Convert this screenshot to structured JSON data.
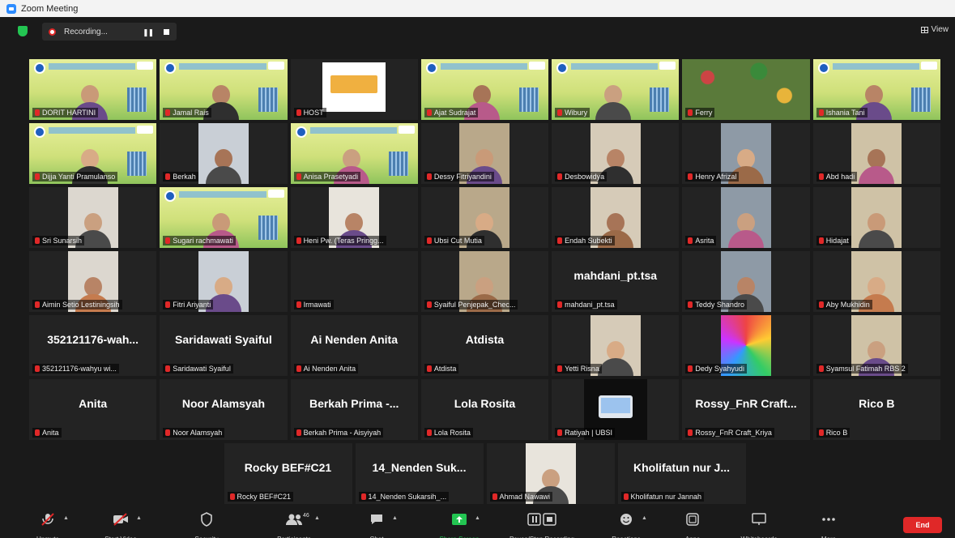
{
  "window": {
    "title": "Zoom Meeting"
  },
  "topbar": {
    "recording_label": "Recording...",
    "view_label": "View"
  },
  "rows": [
    [
      {
        "label": "DORIT HARTINI",
        "type": "banner",
        "active": true
      },
      {
        "label": "Jamal Rais",
        "type": "banner"
      },
      {
        "label": "HOST",
        "type": "screen"
      },
      {
        "label": "Ajat Sudrajat",
        "type": "banner"
      },
      {
        "label": "Wibury",
        "type": "banner"
      },
      {
        "label": "Ferry",
        "type": "floral"
      },
      {
        "label": "Ishania Tani",
        "type": "banner"
      }
    ],
    [
      {
        "label": "Dijja Yanti Pramulanso",
        "type": "banner"
      },
      {
        "label": "Berkah",
        "type": "video"
      },
      {
        "label": "Anisa Prasetyadi",
        "type": "banner"
      },
      {
        "label": "Dessy Fitriyandini",
        "type": "video"
      },
      {
        "label": "Desbowidya",
        "type": "video"
      },
      {
        "label": "Henry Afrizal",
        "type": "video"
      },
      {
        "label": "Abd hadi",
        "type": "video"
      }
    ],
    [
      {
        "label": "Sri Sunarsih",
        "type": "video"
      },
      {
        "label": "Sugari rachmawati",
        "type": "banner"
      },
      {
        "label": "Heni Pw. (Teras Pringg...",
        "type": "video"
      },
      {
        "label": "Ubsi Cut Mutia",
        "type": "video"
      },
      {
        "label": "Endah Subekti",
        "type": "video"
      },
      {
        "label": "Asrita",
        "type": "video"
      },
      {
        "label": "Hidajat",
        "type": "video"
      }
    ],
    [
      {
        "label": "Aimin Setio Lestiningsih",
        "type": "video"
      },
      {
        "label": "Fitri Ariyanti",
        "type": "video"
      },
      {
        "label": "Irmawati",
        "type": "blank"
      },
      {
        "label": "Syaiful Penjepak_Chec...",
        "type": "video"
      },
      {
        "label": "mahdani_pt.tsa",
        "type": "name",
        "name": "mahdani_pt.tsa"
      },
      {
        "label": "Teddy Shandro",
        "type": "video"
      },
      {
        "label": "Aby Mukhidin",
        "type": "video"
      }
    ],
    [
      {
        "label": "352121176-wahyu wi...",
        "type": "name",
        "name": "352121176-wah..."
      },
      {
        "label": "Saridawati Syaiful",
        "type": "name",
        "name": "Saridawati Syaiful"
      },
      {
        "label": "Ai Nenden Anita",
        "type": "name",
        "name": "Ai Nenden Anita"
      },
      {
        "label": "Atdista",
        "type": "name",
        "name": "Atdista"
      },
      {
        "label": "Yetti Risna",
        "type": "video"
      },
      {
        "label": "Dedy Syahyudi",
        "type": "colorful"
      },
      {
        "label": "Syamsul Fatimah RBS 2",
        "type": "video"
      }
    ],
    [
      {
        "label": "Anita",
        "type": "name",
        "name": "Anita"
      },
      {
        "label": "Noor Alamsyah",
        "type": "name",
        "name": "Noor Alamsyah"
      },
      {
        "label": "Berkah Prima - Aisyiyah",
        "type": "name",
        "name": "Berkah Prima -..."
      },
      {
        "label": "Lola Rosita",
        "type": "name",
        "name": "Lola Rosita"
      },
      {
        "label": "Ratiyah | UBSI",
        "type": "laptop"
      },
      {
        "label": "Rossy_FnR Craft_Kriya",
        "type": "name",
        "name": "Rossy_FnR Craft..."
      },
      {
        "label": "Rico B",
        "type": "name",
        "name": "Rico B"
      }
    ],
    [
      {
        "label": "Rocky BEF#C21",
        "type": "name",
        "name": "Rocky BEF#C21"
      },
      {
        "label": "14_Nenden Sukarsih_...",
        "type": "name",
        "name": "14_Nenden Suk..."
      },
      {
        "label": "Ahmad Nawawi",
        "type": "video"
      },
      {
        "label": "Kholifatun nur Jannah",
        "type": "name",
        "name": "Kholifatun nur J..."
      }
    ]
  ],
  "controls": [
    {
      "label": "Unmute",
      "icon": "mic-muted-icon",
      "caret": true
    },
    {
      "label": "Start Video",
      "icon": "video-off-icon",
      "caret": true
    },
    {
      "label": "Security",
      "icon": "shield-icon",
      "caret": false
    },
    {
      "label": "Participants",
      "icon": "participants-icon",
      "caret": true,
      "badge": "46"
    },
    {
      "label": "Chat",
      "icon": "chat-icon",
      "caret": true
    },
    {
      "label": "Share Screen",
      "icon": "share-screen-icon",
      "caret": true,
      "green": true
    },
    {
      "label": "Pause/Stop Recording",
      "icon": "recording-controls-icon",
      "caret": false
    },
    {
      "label": "Reactions",
      "icon": "reactions-icon",
      "caret": true
    },
    {
      "label": "Apps",
      "icon": "apps-icon",
      "caret": false
    },
    {
      "label": "Whiteboards",
      "icon": "whiteboard-icon",
      "caret": false
    },
    {
      "label": "More",
      "icon": "more-icon",
      "caret": false
    }
  ],
  "end_label": "End",
  "colors": {
    "accent_green": "#23c552",
    "end_red": "#e02828",
    "active_speaker": "#c8e33a"
  }
}
